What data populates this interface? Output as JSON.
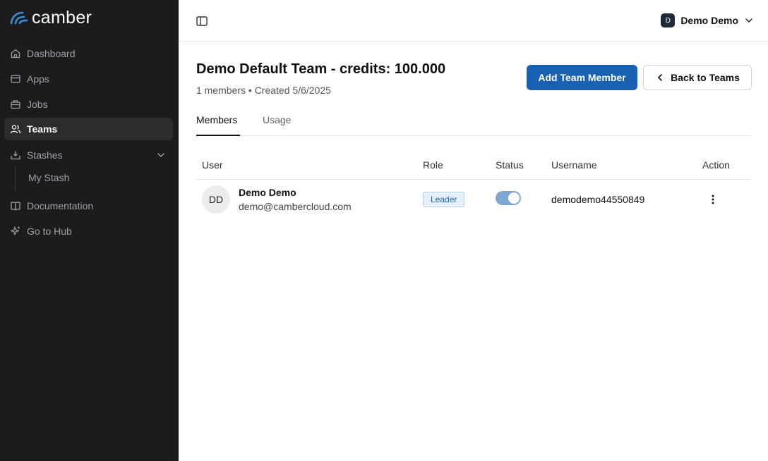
{
  "app": {
    "brand": "camber"
  },
  "sidebar": {
    "items": [
      {
        "label": "Dashboard",
        "icon": "home-icon"
      },
      {
        "label": "Apps",
        "icon": "apps-icon"
      },
      {
        "label": "Jobs",
        "icon": "jobs-icon"
      },
      {
        "label": "Teams",
        "icon": "users-icon",
        "active": true
      },
      {
        "label": "Stashes",
        "icon": "stash-icon",
        "expanded": true,
        "children": [
          {
            "label": "My Stash"
          }
        ]
      },
      {
        "label": "Documentation",
        "icon": "book-icon"
      },
      {
        "label": "Go to Hub",
        "icon": "sparkle-icon"
      }
    ]
  },
  "topbar": {
    "user_initial": "D",
    "user_name": "Demo Demo"
  },
  "header": {
    "title": "Demo Default Team - credits: 100.000",
    "subtitle": "1 members • Created 5/6/2025",
    "add_button": "Add Team Member",
    "back_button": "Back to Teams"
  },
  "tabs": [
    {
      "label": "Members",
      "active": true
    },
    {
      "label": "Usage"
    }
  ],
  "table": {
    "columns": [
      "User",
      "Role",
      "Status",
      "Username",
      "Action"
    ],
    "rows": [
      {
        "initials": "DD",
        "name": "Demo Demo",
        "email": "demo@cambercloud.com",
        "role": "Leader",
        "status_on": true,
        "username": "demodemo44550849"
      }
    ]
  },
  "colors": {
    "accent": "#1861b3",
    "sidebar_bg": "#1c1c1e",
    "logo_blue": "#3b8fd9"
  }
}
